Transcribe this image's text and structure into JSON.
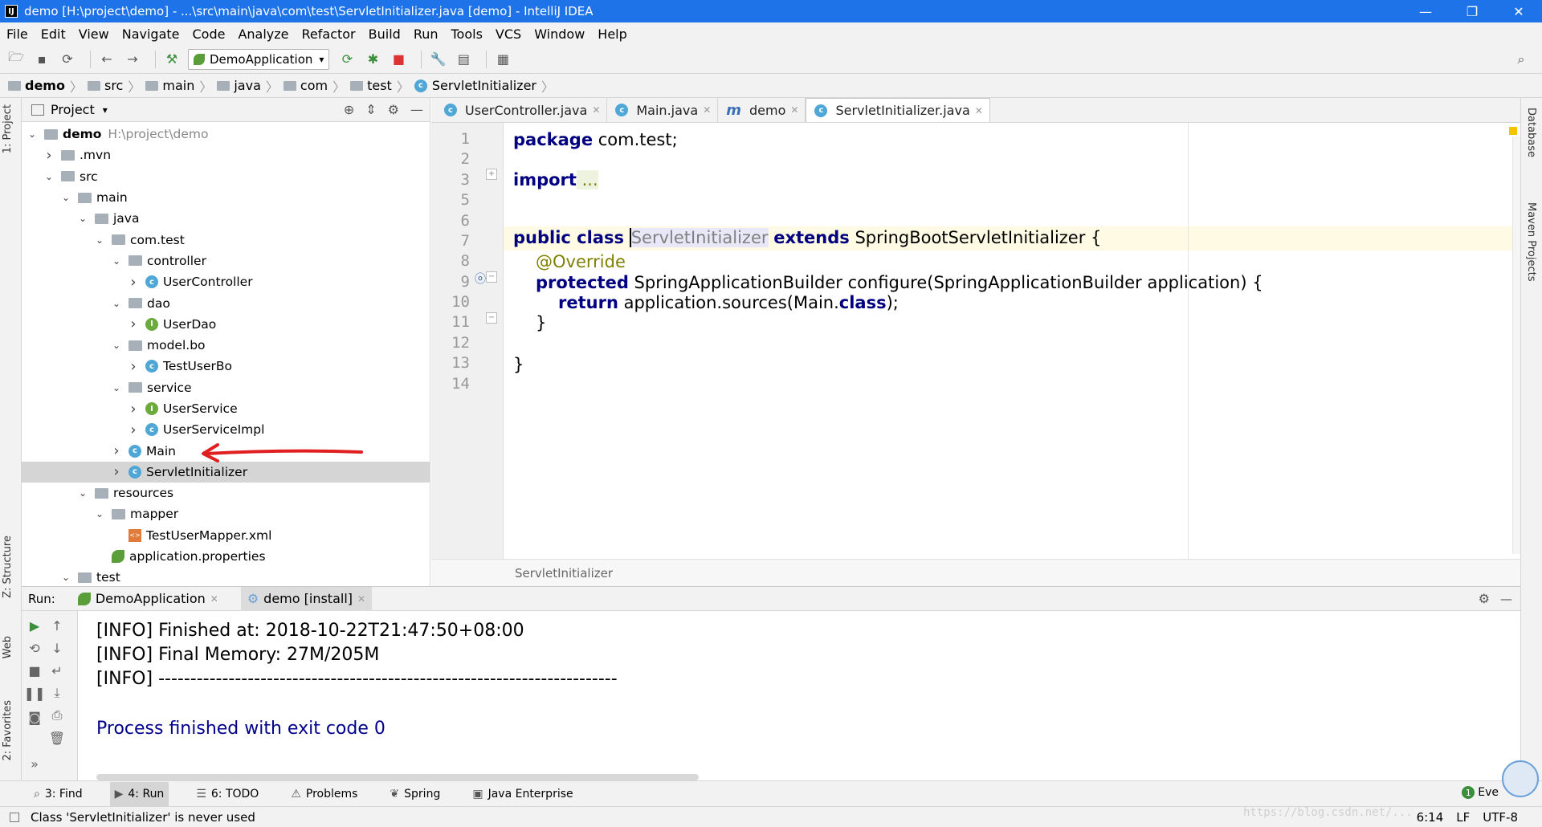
{
  "window": {
    "title": "demo [H:\\project\\demo] - ...\\src\\main\\java\\com\\test\\ServletInitializer.java [demo] - IntelliJ IDEA",
    "app_icon_letter": "IJ"
  },
  "menu": [
    "File",
    "Edit",
    "View",
    "Navigate",
    "Code",
    "Analyze",
    "Refactor",
    "Build",
    "Run",
    "Tools",
    "VCS",
    "Window",
    "Help"
  ],
  "toolbar": {
    "run_config": "DemoApplication"
  },
  "breadcrumb": [
    "demo",
    "src",
    "main",
    "java",
    "com",
    "test",
    "ServletInitializer"
  ],
  "project_panel": {
    "title": "Project",
    "tree": [
      {
        "label": "demo",
        "extra": "H:\\project\\demo",
        "depth": 0,
        "arrow": "down",
        "icon": "folder",
        "bold": true
      },
      {
        "label": ".mvn",
        "depth": 1,
        "arrow": "right",
        "icon": "folder"
      },
      {
        "label": "src",
        "depth": 1,
        "arrow": "down",
        "icon": "folder"
      },
      {
        "label": "main",
        "depth": 2,
        "arrow": "down",
        "icon": "folder"
      },
      {
        "label": "java",
        "depth": 3,
        "arrow": "down",
        "icon": "folder"
      },
      {
        "label": "com.test",
        "depth": 4,
        "arrow": "down",
        "icon": "folder"
      },
      {
        "label": "controller",
        "depth": 5,
        "arrow": "down",
        "icon": "folder"
      },
      {
        "label": "UserController",
        "depth": 6,
        "arrow": "right",
        "icon": "class"
      },
      {
        "label": "dao",
        "depth": 5,
        "arrow": "down",
        "icon": "folder"
      },
      {
        "label": "UserDao",
        "depth": 6,
        "arrow": "right",
        "icon": "interface"
      },
      {
        "label": "model.bo",
        "depth": 5,
        "arrow": "down",
        "icon": "folder"
      },
      {
        "label": "TestUserBo",
        "depth": 6,
        "arrow": "right",
        "icon": "class"
      },
      {
        "label": "service",
        "depth": 5,
        "arrow": "down",
        "icon": "folder"
      },
      {
        "label": "UserService",
        "depth": 6,
        "arrow": "right",
        "icon": "interface"
      },
      {
        "label": "UserServiceImpl",
        "depth": 6,
        "arrow": "right",
        "icon": "class"
      },
      {
        "label": "Main",
        "depth": 5,
        "arrow": "right",
        "icon": "class"
      },
      {
        "label": "ServletInitializer",
        "depth": 5,
        "arrow": "right",
        "icon": "class",
        "selected": true
      },
      {
        "label": "resources",
        "depth": 3,
        "arrow": "down",
        "icon": "folder"
      },
      {
        "label": "mapper",
        "depth": 4,
        "arrow": "down",
        "icon": "folder"
      },
      {
        "label": "TestUserMapper.xml",
        "depth": 5,
        "arrow": "",
        "icon": "xml"
      },
      {
        "label": "application.properties",
        "depth": 4,
        "arrow": "",
        "icon": "properties"
      },
      {
        "label": "test",
        "depth": 2,
        "arrow": "down",
        "icon": "folder"
      }
    ]
  },
  "editor": {
    "tabs": [
      {
        "label": "UserController.java",
        "icon": "C"
      },
      {
        "label": "Main.java",
        "icon": "C"
      },
      {
        "label": "demo",
        "icon": "m"
      },
      {
        "label": "ServletInitializer.java",
        "icon": "C",
        "active": true
      }
    ],
    "line_numbers": [
      "1",
      "2",
      "3",
      "5",
      "6",
      "7",
      "8",
      "9",
      "10",
      "11",
      "12",
      "13",
      "14"
    ],
    "code": {
      "l1_kw": "package",
      "l1_rest": " com.test;",
      "l3_kw": "import",
      "l3_rest": " ...",
      "l6_kw1": "public class",
      "l6_unused": "ServletInitializer",
      "l6_kw2": "extends",
      "l6_rest": " SpringBootServletInitializer {",
      "l8_ann": "@Override",
      "l9_kw": "protected",
      "l9_rest": " SpringApplicationBuilder configure(SpringApplicationBuilder application) {",
      "l10_kw": "return",
      "l10_rest1": " application.sources(Main.",
      "l10_kw2": "class",
      "l10_rest2": ");",
      "l11": "}",
      "l13": "}"
    },
    "status_class": "ServletInitializer"
  },
  "run_panel": {
    "label": "Run:",
    "tabs": [
      {
        "label": "DemoApplication"
      },
      {
        "label": "demo [install]",
        "active": true
      }
    ],
    "output": [
      "[INFO] Finished at: 2018-10-22T21:47:50+08:00",
      "[INFO] Final Memory: 27M/205M",
      "[INFO] ------------------------------------------------------------------------",
      "Process finished with exit code 0"
    ]
  },
  "bottom_tools": [
    {
      "label": "3: Find",
      "icon": "⌕"
    },
    {
      "label": "4: Run",
      "icon": "▶",
      "active": true
    },
    {
      "label": "6: TODO",
      "icon": "☰"
    },
    {
      "label": "Problems",
      "icon": "⚠"
    },
    {
      "label": "Spring",
      "icon": "❦"
    },
    {
      "label": "Java Enterprise",
      "icon": "▣"
    }
  ],
  "side_tabs": {
    "left": [
      "1: Project",
      "Z: Structure",
      "Web",
      "2: Favorites"
    ],
    "right": [
      "Database",
      "Maven Projects"
    ]
  },
  "status": {
    "message": "Class 'ServletInitializer' is never used",
    "position": "6:14",
    "line_sep": "LF",
    "encoding": "UTF-8",
    "event_log": "Eve"
  },
  "watermark": "https://blog.csdn.net/..."
}
